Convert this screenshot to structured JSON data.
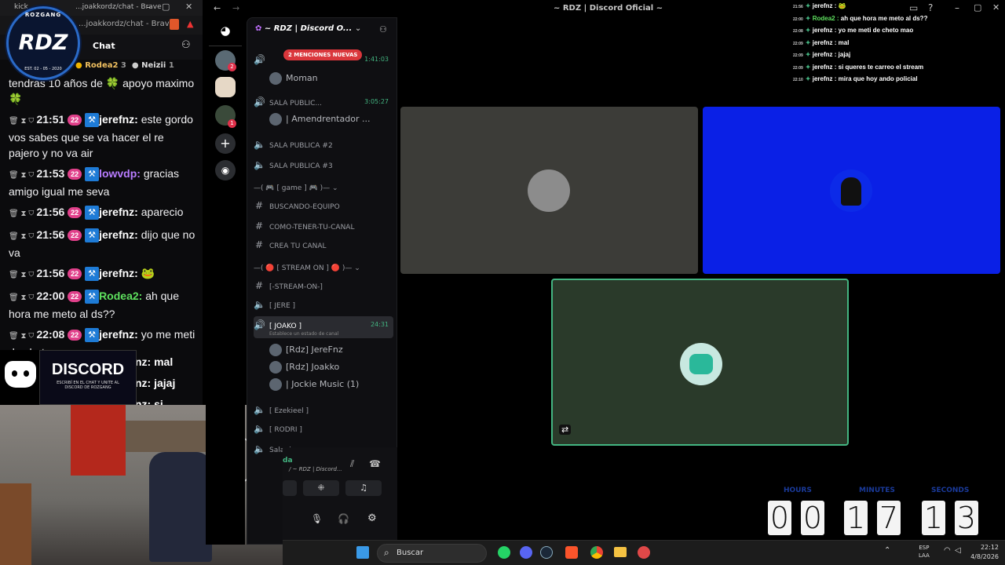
{
  "browser": {
    "tab_label": "kick",
    "url": "...joakkordz/chat - Brave"
  },
  "chat": {
    "header": "Chat",
    "top_users": [
      {
        "name": "Rodea2",
        "count": "3"
      },
      {
        "name": "Neizii",
        "count": "1"
      }
    ],
    "messages": [
      {
        "time": "",
        "user": "",
        "text": "tendras 10 años de 🍀 apoyo maximo 🍀",
        "color": "#ffffff"
      },
      {
        "time": "21:51",
        "user": "jerefnz:",
        "text": "este gordo vos sabes que se va hacer el re pajero y no va air",
        "color": "#ffffff"
      },
      {
        "time": "21:53",
        "user": "lowvdp:",
        "text": "gracias amigo igual me seva",
        "color": "#b87cff"
      },
      {
        "time": "21:56",
        "user": "jerefnz:",
        "text": "aparecio",
        "color": "#ffffff"
      },
      {
        "time": "21:56",
        "user": "jerefnz:",
        "text": "dijo que no va",
        "color": "#ffffff"
      },
      {
        "time": "21:56",
        "user": "jerefnz:",
        "text": "🐸",
        "color": "#ffffff"
      },
      {
        "time": "22:00",
        "user": "Rodea2:",
        "text": "ah que hora me meto al ds??",
        "color": "#5ee05e"
      },
      {
        "time": "22:08",
        "user": "jerefnz:",
        "text": "yo me meti de cheto mao",
        "color": "#ffffff"
      }
    ],
    "partial": [
      "nz: mal",
      "nz: jajaj",
      "nz: si"
    ]
  },
  "logo": {
    "text": "RDZ",
    "ring": "ROZGANG",
    "est": "EST. 02 - 05 - 2020"
  },
  "discord_ad": {
    "title": "DISCORD",
    "sub": "ESCRIBÍ EN EL CHAT Y UNITE AL DISCORD DE ROZGANG"
  },
  "window_title": "~ RDZ | Discord Oficial ~",
  "server": {
    "name": "~ RDZ | Discord O...",
    "mentions": "2 MENCIONES NUEVAS"
  },
  "channels": [
    {
      "name": "",
      "time": "1:41:03"
    },
    {
      "name": "Moman",
      "type": "user"
    },
    {
      "name": "SALA PUBLIC...",
      "time": "3:05:27"
    },
    {
      "name": "| Amendrentador ...",
      "type": "user"
    },
    {
      "name": "SALA PUBLICA #2"
    },
    {
      "name": "SALA PUBLICA #3"
    },
    {
      "name": "—( 🎮 [ game ] 🎮 )— ⌄",
      "type": "cat"
    },
    {
      "name": "BUSCANDO-EQUIPO"
    },
    {
      "name": "COMO-TENER-TU-CANAL"
    },
    {
      "name": "CREA TU CANAL"
    },
    {
      "name": "—( 🔴 [ STREAM ON ] 🔴 )— ⌄",
      "type": "cat"
    },
    {
      "name": "[-STREAM-ON-]"
    },
    {
      "name": "[ JERE ]"
    },
    {
      "name": "[ JOAKO ]",
      "time": "24:31",
      "status": "Establece un estado de canal"
    },
    {
      "name": "[Rdz] JereFnz",
      "type": "user"
    },
    {
      "name": "[Rdz] Joakko",
      "type": "user"
    },
    {
      "name": "| Jockie Music (1)",
      "type": "user"
    },
    {
      "name": "[ Ezekieel ]"
    },
    {
      "name": "[ RODRI ]"
    },
    {
      "name": "Sala de espera"
    }
  ],
  "voice_panel": {
    "status": "da",
    "channel": "/ ~ RDZ | Discord..."
  },
  "overlay": [
    {
      "time": "21:56",
      "user": "jerefnz :",
      "text": "🐸",
      "color": "#ffffff"
    },
    {
      "time": "22:00",
      "user": "Rodea2 :",
      "text": "ah que hora me meto al ds??",
      "color": "#5ee05e"
    },
    {
      "time": "22:08",
      "user": "jerefnz :",
      "text": "yo me meti de cheto mao",
      "color": "#ffffff"
    },
    {
      "time": "22:09",
      "user": "jerefnz :",
      "text": "mal",
      "color": "#ffffff"
    },
    {
      "time": "22:09",
      "user": "jerefnz :",
      "text": "jajaj",
      "color": "#ffffff"
    },
    {
      "time": "22:09",
      "user": "jerefnz :",
      "text": "si queres te carreo el stream",
      "color": "#ffffff"
    },
    {
      "time": "22:10",
      "user": "jerefnz :",
      "text": "mira que hoy ando policial",
      "color": "#ffffff"
    }
  ],
  "timer": {
    "labels": [
      "HOURS",
      "MINUTES",
      "SECONDS"
    ],
    "digits": [
      "0",
      "0",
      "1",
      "7",
      "1",
      "3"
    ]
  },
  "taskbar": {
    "search": "Buscar",
    "lang1": "ESP",
    "lang2": "LAA",
    "time": "22:12",
    "date": "4/8/2026"
  },
  "colors": {
    "discord_blue": "#0a20e6",
    "green_tile": "#2a3a2a",
    "gray_tile": "#3c3c38",
    "speaking": "#43b581"
  }
}
